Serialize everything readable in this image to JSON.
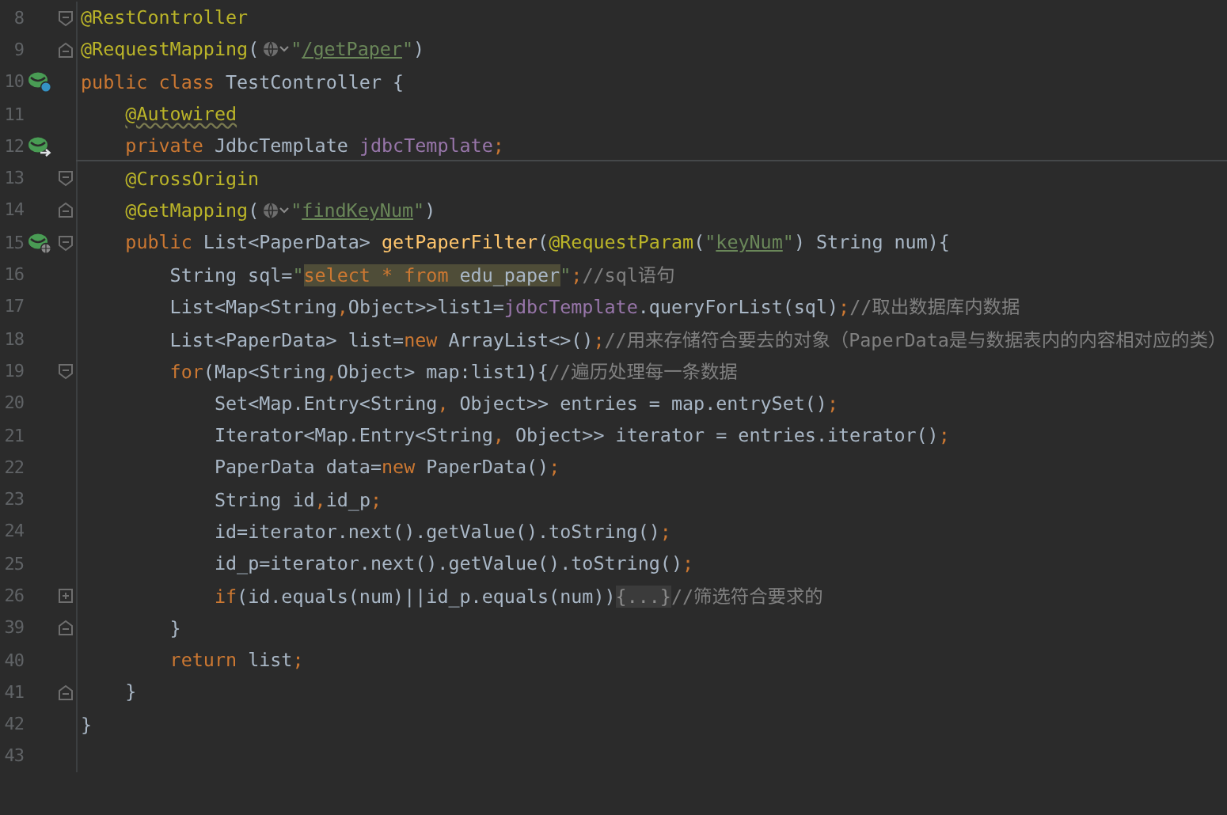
{
  "editor": {
    "lines": [
      {
        "number": "8",
        "fold": {
          "kind": "start"
        },
        "tokens": [
          {
            "kind": "annotation",
            "text": "@RestController"
          }
        ]
      },
      {
        "number": "9",
        "fold": {
          "kind": "end"
        },
        "tokens": [
          {
            "kind": "annotation",
            "text": "@RequestMapping"
          },
          {
            "kind": "plain",
            "text": "("
          },
          {
            "kind": "inlay"
          },
          {
            "kind": "string",
            "text": "\""
          },
          {
            "kind": "link",
            "text": "/getPaper"
          },
          {
            "kind": "string",
            "text": "\""
          },
          {
            "kind": "plain",
            "text": ")"
          }
        ]
      },
      {
        "number": "10",
        "gutter_icon": {
          "kind": "bean-web"
        },
        "tokens": [
          {
            "kind": "keyword",
            "text": "public class "
          },
          {
            "kind": "plain",
            "text": "TestController {"
          }
        ]
      },
      {
        "number": "11",
        "tokens": [
          {
            "kind": "annotation-warn",
            "text": "    @Autowired"
          }
        ]
      },
      {
        "number": "12",
        "gutter_icon": {
          "kind": "bean-autowired"
        },
        "separator_below": true,
        "tokens": [
          {
            "kind": "keyword",
            "text": "    private "
          },
          {
            "kind": "plain",
            "text": "JdbcTemplate "
          },
          {
            "kind": "field",
            "text": "jdbcTemplate"
          },
          {
            "kind": "punct",
            "text": ";"
          }
        ]
      },
      {
        "number": "13",
        "fold": {
          "kind": "start"
        },
        "tokens": [
          {
            "kind": "annotation",
            "text": "    @CrossOrigin"
          }
        ]
      },
      {
        "number": "14",
        "fold": {
          "kind": "end"
        },
        "tokens": [
          {
            "kind": "annotation",
            "text": "    @GetMapping"
          },
          {
            "kind": "plain",
            "text": "("
          },
          {
            "kind": "inlay"
          },
          {
            "kind": "string",
            "text": "\""
          },
          {
            "kind": "link",
            "text": "findKeyNum"
          },
          {
            "kind": "string",
            "text": "\""
          },
          {
            "kind": "plain",
            "text": ")"
          }
        ]
      },
      {
        "number": "15",
        "gutter_icon": {
          "kind": "bean-endpoint"
        },
        "fold": {
          "kind": "start"
        },
        "tokens": [
          {
            "kind": "keyword",
            "text": "    public "
          },
          {
            "kind": "plain",
            "text": "List<PaperData> "
          },
          {
            "kind": "method",
            "text": "getPaperFilter"
          },
          {
            "kind": "plain",
            "text": "("
          },
          {
            "kind": "annotation",
            "text": "@RequestParam"
          },
          {
            "kind": "plain",
            "text": "("
          },
          {
            "kind": "string",
            "text": "\""
          },
          {
            "kind": "link",
            "text": "keyNum"
          },
          {
            "kind": "string",
            "text": "\""
          },
          {
            "kind": "plain",
            "text": ") String num){"
          }
        ]
      },
      {
        "number": "16",
        "tokens": [
          {
            "kind": "plain",
            "text": "        String sql="
          },
          {
            "kind": "string",
            "text": "\""
          },
          {
            "kind": "sql-keyword",
            "text": "select * from "
          },
          {
            "kind": "sql-plain",
            "text": "edu_paper"
          },
          {
            "kind": "string",
            "text": "\""
          },
          {
            "kind": "punct",
            "text": ";"
          },
          {
            "kind": "comment",
            "text": "//sql语句"
          }
        ]
      },
      {
        "number": "17",
        "tokens": [
          {
            "kind": "plain",
            "text": "        List<Map<String"
          },
          {
            "kind": "punct",
            "text": ","
          },
          {
            "kind": "plain",
            "text": "Object>>list1="
          },
          {
            "kind": "field",
            "text": "jdbcTemplate"
          },
          {
            "kind": "plain",
            "text": ".queryForList(sql)"
          },
          {
            "kind": "punct",
            "text": ";"
          },
          {
            "kind": "comment",
            "text": "//取出数据库内数据"
          }
        ]
      },
      {
        "number": "18",
        "tokens": [
          {
            "kind": "plain",
            "text": "        List<PaperData> list="
          },
          {
            "kind": "keyword",
            "text": "new "
          },
          {
            "kind": "plain",
            "text": "ArrayList<>()"
          },
          {
            "kind": "punct",
            "text": ";"
          },
          {
            "kind": "comment",
            "text": "//用来存储符合要去的对象（PaperData是与数据表内的内容相对应的类）"
          }
        ]
      },
      {
        "number": "19",
        "fold": {
          "kind": "start"
        },
        "tokens": [
          {
            "kind": "keyword",
            "text": "        for"
          },
          {
            "kind": "plain",
            "text": "(Map<String"
          },
          {
            "kind": "punct",
            "text": ","
          },
          {
            "kind": "plain",
            "text": "Object> map:list1){"
          },
          {
            "kind": "comment",
            "text": "//遍历处理每一条数据"
          }
        ]
      },
      {
        "number": "20",
        "tokens": [
          {
            "kind": "plain",
            "text": "            Set<Map.Entry<String"
          },
          {
            "kind": "punct",
            "text": ", "
          },
          {
            "kind": "plain",
            "text": "Object>> entries = map.entrySet()"
          },
          {
            "kind": "punct",
            "text": ";"
          }
        ]
      },
      {
        "number": "21",
        "tokens": [
          {
            "kind": "plain",
            "text": "            Iterator<Map.Entry<String"
          },
          {
            "kind": "punct",
            "text": ", "
          },
          {
            "kind": "plain",
            "text": "Object>> iterator = entries.iterator()"
          },
          {
            "kind": "punct",
            "text": ";"
          }
        ]
      },
      {
        "number": "22",
        "tokens": [
          {
            "kind": "plain",
            "text": "            PaperData data="
          },
          {
            "kind": "keyword",
            "text": "new "
          },
          {
            "kind": "plain",
            "text": "PaperData()"
          },
          {
            "kind": "punct",
            "text": ";"
          }
        ]
      },
      {
        "number": "23",
        "tokens": [
          {
            "kind": "plain",
            "text": "            String id"
          },
          {
            "kind": "punct",
            "text": ","
          },
          {
            "kind": "plain",
            "text": "id_p"
          },
          {
            "kind": "punct",
            "text": ";"
          }
        ]
      },
      {
        "number": "24",
        "tokens": [
          {
            "kind": "plain",
            "text": "            id=iterator.next().getValue().toString()"
          },
          {
            "kind": "punct",
            "text": ";"
          }
        ]
      },
      {
        "number": "25",
        "tokens": [
          {
            "kind": "plain",
            "text": "            id_p=iterator.next().getValue().toString()"
          },
          {
            "kind": "punct",
            "text": ";"
          }
        ]
      },
      {
        "number": "26",
        "fold": {
          "kind": "collapsed"
        },
        "tokens": [
          {
            "kind": "keyword",
            "text": "            if"
          },
          {
            "kind": "plain",
            "text": "(id.equals(num)||id_p.equals(num))"
          },
          {
            "kind": "folded",
            "text": "{...}"
          },
          {
            "kind": "comment",
            "text": "//筛选符合要求的"
          }
        ]
      },
      {
        "number": "39",
        "fold": {
          "kind": "end"
        },
        "tokens": [
          {
            "kind": "plain",
            "text": "        }"
          }
        ]
      },
      {
        "number": "40",
        "tokens": [
          {
            "kind": "keyword",
            "text": "        return "
          },
          {
            "kind": "plain",
            "text": "list"
          },
          {
            "kind": "punct",
            "text": ";"
          }
        ]
      },
      {
        "number": "41",
        "fold": {
          "kind": "end"
        },
        "tokens": [
          {
            "kind": "plain",
            "text": "    }"
          }
        ]
      },
      {
        "number": "42",
        "tokens": [
          {
            "kind": "plain",
            "text": "}"
          }
        ]
      },
      {
        "number": "43"
      }
    ]
  }
}
